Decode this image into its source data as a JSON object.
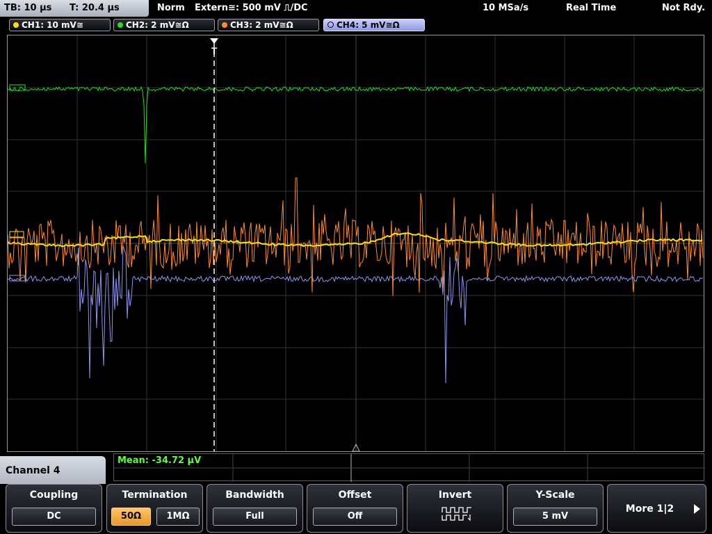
{
  "status": {
    "timebase": "TB: 10 µs",
    "trigger_time": "T: 20.4 µs",
    "trigger_mode": "Norm",
    "trigger_source": "Extern≅: 500 mV ⎍/DC",
    "sample_rate": "10 MSa/s",
    "acquisition_mode": "Real Time",
    "state": "Not Rdy."
  },
  "channels": [
    {
      "label": "CH1: 10 mV≅",
      "color": "#ffe200"
    },
    {
      "label": "CH2: 2 mV≅Ω",
      "color": "#22e022"
    },
    {
      "label": "CH3: 2 mV≅Ω",
      "color": "#ff8c2a"
    },
    {
      "label": "CH4: 5 mV≅Ω",
      "color": "#8f96f0"
    }
  ],
  "trigger_marker": "T",
  "measurement": {
    "mean": "Mean: -34.72 µV"
  },
  "menu": {
    "channel_title": "Channel 4",
    "coupling": {
      "title": "Coupling",
      "value": "DC"
    },
    "termination": {
      "title": "Termination",
      "option_50": "50Ω",
      "option_1m": "1MΩ",
      "selected": "50Ω"
    },
    "bandwidth": {
      "title": "Bandwidth",
      "value": "Full"
    },
    "offset": {
      "title": "Offset",
      "value": "Off"
    },
    "invert": {
      "title": "Invert",
      "icon": "invert-waveform-icon"
    },
    "y_scale": {
      "title": "Y-Scale",
      "value": "5 mV"
    },
    "more": {
      "label": "More 1|2",
      "icon": "arrow-right-icon"
    }
  }
}
